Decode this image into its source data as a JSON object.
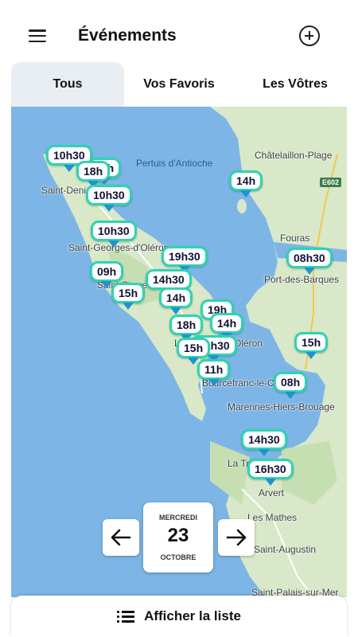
{
  "appbar": {
    "title": "Événements",
    "menu_icon": "hamburger-menu-icon",
    "add_icon": "plus-circle-icon"
  },
  "tabs": [
    {
      "label": "Tous",
      "active": true
    },
    {
      "label": "Vos Favoris",
      "active": false
    },
    {
      "label": "Les Vôtres",
      "active": false
    }
  ],
  "map": {
    "place_labels": [
      "Châtelaillon-Plage",
      "Saint-Denis-d'Oléron",
      "Saint-Georges-d'Oléron",
      "Fouras",
      "Port-des-Barques",
      "Saint-Pierre-d'Oléron",
      "Le Château-d'Oléron",
      "Bourcefranc-le-Chapus",
      "Marennes-Hiers-Brouage",
      "La Tremblade",
      "Arvert",
      "Les Mathes",
      "Saint-Augustin",
      "Saint-Palais-sur-Mer"
    ],
    "sea_label": "Pertuis d'Antioche",
    "road_badge": "E602",
    "markers": [
      "10h30",
      "19h",
      "18h",
      "10h30",
      "14h",
      "10h30",
      "19h30",
      "08h30",
      "09h",
      "14h30",
      "15h",
      "14h",
      "19h",
      "18h",
      "14h",
      "19h30",
      "15h",
      "15h",
      "11h",
      "08h",
      "14h30",
      "16h30"
    ]
  },
  "date": {
    "weekday": "MERCREDI",
    "day": "23",
    "month": "OCTOBRE",
    "prev_icon": "arrow-left-icon",
    "next_icon": "arrow-right-icon"
  },
  "list_button": {
    "label": "Afficher la liste",
    "icon": "list-icon"
  },
  "colors": {
    "sea": "#7db6e6",
    "land": "#d8e8c8",
    "marker_border": "#2fd3b2",
    "marker_tail": "#1e93cf",
    "tab_active_bg": "#e9eef2"
  }
}
